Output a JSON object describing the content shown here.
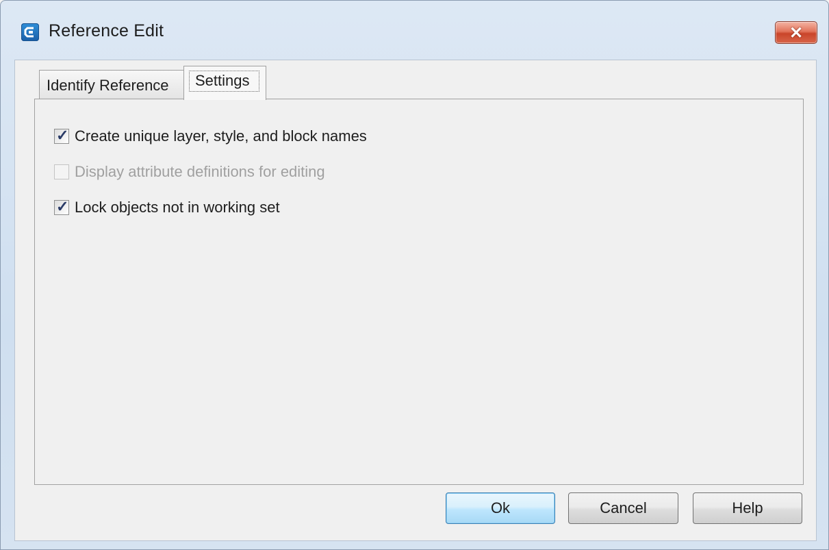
{
  "window": {
    "title": "Reference Edit",
    "close_symbol": "✕",
    "icon": "app-logo-icon"
  },
  "tabs": [
    {
      "label": "Identify Reference",
      "active": false
    },
    {
      "label": "Settings",
      "active": true
    }
  ],
  "settings": {
    "options": [
      {
        "label": "Create unique layer, style, and block names",
        "checked": true,
        "enabled": true
      },
      {
        "label": "Display attribute definitions for editing",
        "checked": false,
        "enabled": false
      },
      {
        "label": "Lock objects not in working set",
        "checked": true,
        "enabled": true
      }
    ]
  },
  "buttons": {
    "ok": "Ok",
    "cancel": "Cancel",
    "help": "Help"
  },
  "colors": {
    "close_button": "#d8654a",
    "default_button_border": "#3c7fb1",
    "disabled_text": "#a0a0a0"
  }
}
